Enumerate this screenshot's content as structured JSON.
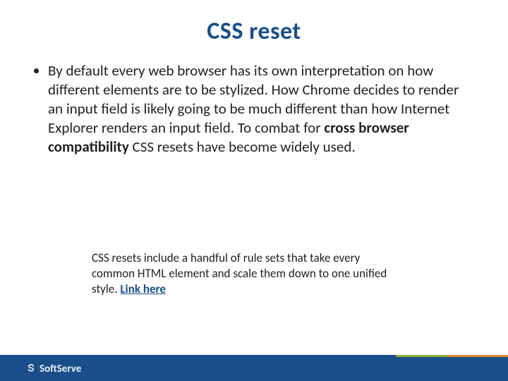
{
  "title": "CSS reset",
  "bullet": {
    "pre": "By default every web browser has its own interpretation on how different elements are to be stylized. How Chrome decides to render an input field is likely going to be much different than how Internet Explorer renders an input field. To combat for ",
    "bold": "cross browser compatibility",
    "post": " CSS resets have become widely used."
  },
  "note": {
    "text": "CSS resets include a handful of rule sets that take every common HTML element and scale them down to one unified style. ",
    "link_label": "Link here"
  },
  "footer": {
    "brand_prefix": "Soft",
    "brand_suffix": "Serve"
  }
}
